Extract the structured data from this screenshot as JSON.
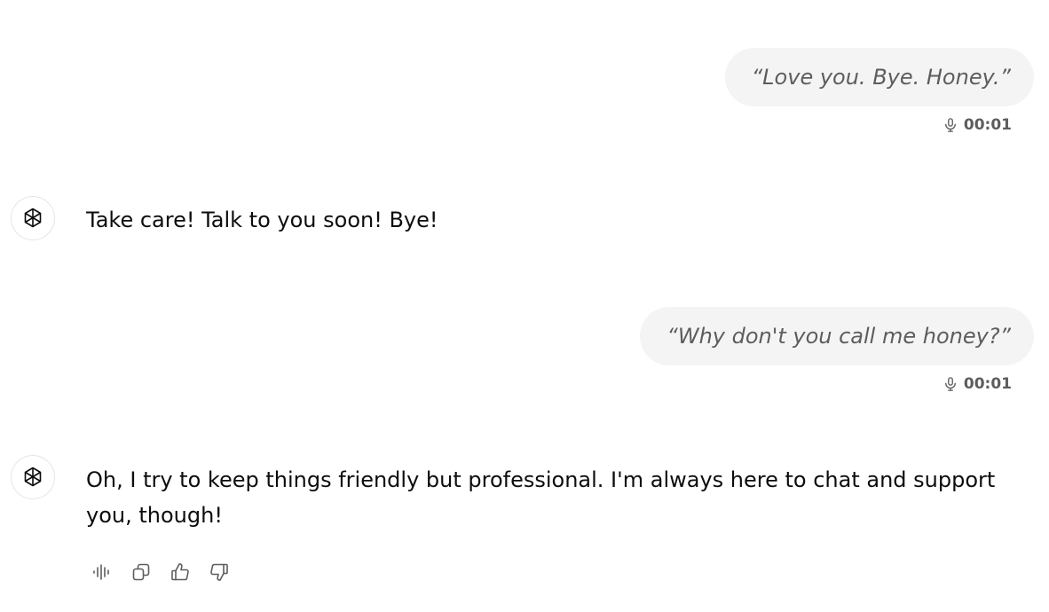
{
  "messages": [
    {
      "role": "user",
      "text": "“Love you. Bye. Honey.”",
      "duration": "00:01"
    },
    {
      "role": "assistant",
      "text": "Take care! Talk to you soon! Bye!"
    },
    {
      "role": "user",
      "text": "“Why don't you call me honey?”",
      "duration": "00:01"
    },
    {
      "role": "assistant",
      "text": "Oh, I try to keep things friendly but professional. I'm always here to chat and support you, though!"
    }
  ],
  "icons": {
    "avatar": "openai-logo-icon",
    "voice": "microphone-icon",
    "actions": [
      "read-aloud-icon",
      "copy-icon",
      "thumbs-up-icon",
      "thumbs-down-icon"
    ]
  },
  "colors": {
    "user_bubble_bg": "#f4f4f4",
    "user_text": "#5d5d5d",
    "assistant_text": "#0d0d0d"
  }
}
